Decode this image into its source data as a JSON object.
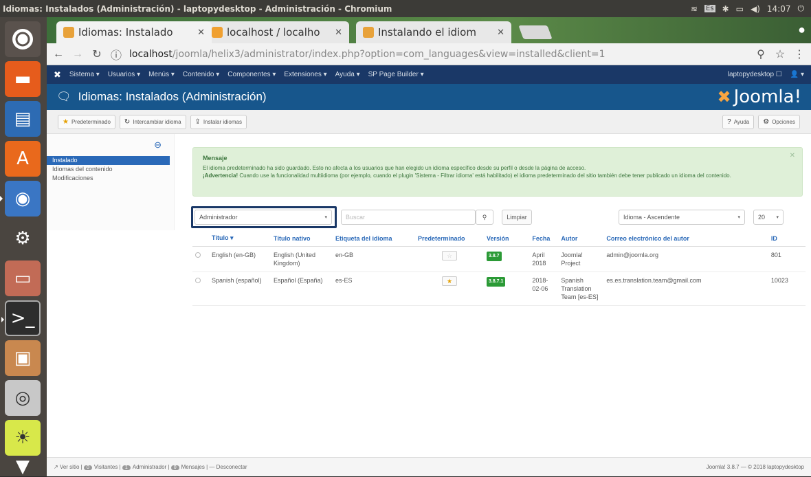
{
  "window": {
    "title": "Idiomas: Instalados (Administración) - laptopydesktop - Administración - Chromium",
    "time": "14:07"
  },
  "tabs": [
    {
      "label": "Idiomas: Instalado",
      "color": "#e8a23a"
    },
    {
      "label": "localhost / localho",
      "color": "#f0a030"
    },
    {
      "label": "Instalando el idiom",
      "color": "#e8a23a"
    }
  ],
  "address": {
    "host": "localhost",
    "path": "/joomla/helix3/administrator/index.php?option=com_languages&view=installed&client=1"
  },
  "nav": {
    "items": [
      "Sistema ▾",
      "Usuarios ▾",
      "Menús ▾",
      "Contenido ▾",
      "Componentes ▾",
      "Extensiones ▾",
      "Ayuda ▾",
      "SP Page Builder ▾"
    ],
    "site": "laptopydesktop ☐",
    "user": "👤 ▾"
  },
  "header": {
    "title": "Idiomas: Instalados (Administración)",
    "logo": "Joomla!"
  },
  "toolbar": {
    "default": "Predeterminado",
    "switch": "Intercambiar idioma",
    "install": "Instalar idiomas",
    "help": "Ayuda",
    "options": "Opciones"
  },
  "sidebar": {
    "items": [
      "Instalado",
      "Idiomas del contenido",
      "Modificaciones"
    ]
  },
  "message": {
    "heading": "Mensaje",
    "line1": "El idioma predeterminado ha sido guardado. Esto no afecta a los usuarios que han elegido un idioma específico desde su perfil o desde la página de acceso.",
    "warn": "¡Advertencia!",
    "line2": " Cuando use la funcionalidad multiidioma (por ejemplo, cuando el plugin 'Sistema - Filtrar idioma' está habilitado) el idioma predeterminado del sitio también debe tener publicado un idioma del contenido."
  },
  "filters": {
    "client": "Administrador",
    "search_placeholder": "Buscar",
    "clear": "Limpiar",
    "ordering": "Idioma - Ascendente",
    "limit": "20"
  },
  "table": {
    "headers": [
      "Título ▾",
      "Título nativo",
      "Etiqueta del idioma",
      "Predeterminado",
      "Versión",
      "Fecha",
      "Autor",
      "Correo electrónico del autor",
      "ID"
    ],
    "rows": [
      {
        "title": "English (en-GB)",
        "native": "English (United Kingdom)",
        "tag": "en-GB",
        "default": false,
        "version": "3.8.7",
        "date": "April 2018",
        "author": "Joomla! Project",
        "email": "admin@joomla.org",
        "id": "801"
      },
      {
        "title": "Spanish (español)",
        "native": "Español (España)",
        "tag": "es-ES",
        "default": true,
        "version": "3.8.7.1",
        "date": "2018-02-06",
        "author": "Spanish Translation Team [es-ES]",
        "email": "es.es.translation.team@gmail.com",
        "id": "10023"
      }
    ]
  },
  "status": {
    "view": "Ver sitio",
    "visitors": "Visitantes",
    "admin": "Administrador",
    "messages": "Mensajes",
    "logout": "Desconectar",
    "counts": [
      "0",
      "1",
      "0"
    ],
    "footer": "Joomla! 3.8.7 — © 2018 laptopydesktop"
  }
}
